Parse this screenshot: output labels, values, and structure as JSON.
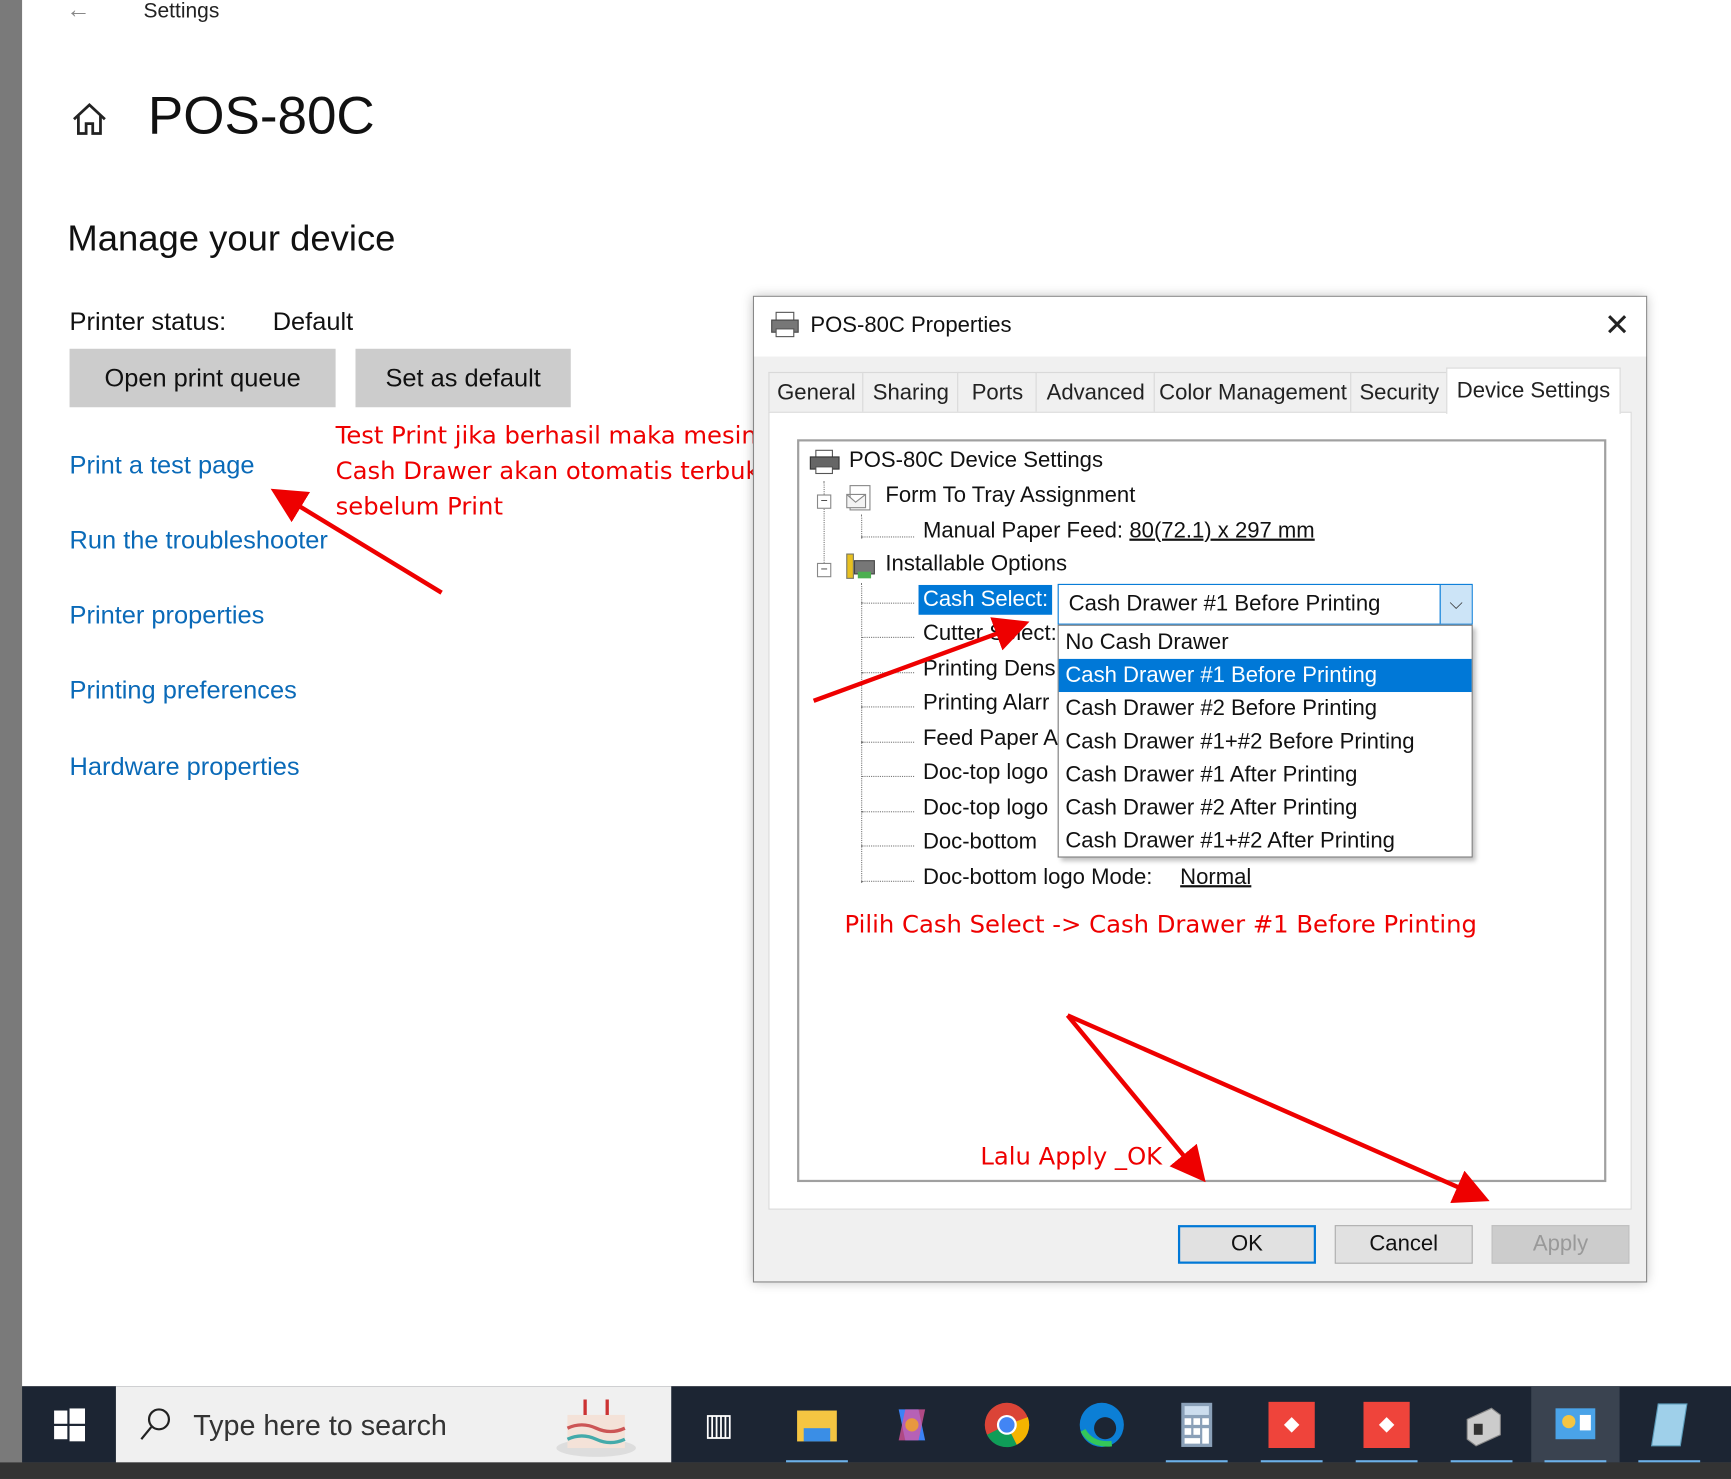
{
  "settings": {
    "window_title": "Settings",
    "page_title": "POS-80C",
    "section": "Manage your device",
    "status_label": "Printer status:",
    "status_value": "Default",
    "open_queue": "Open print queue",
    "set_default": "Set as default",
    "links": [
      "Print a test page",
      "Run the troubleshooter",
      "Printer properties",
      "Printing preferences",
      "Hardware properties"
    ]
  },
  "annotations": {
    "test_print": [
      "Test Print jika berhasil maka mesin",
      "Cash Drawer akan otomatis terbuka",
      "sebelum Print"
    ],
    "cash_select": "Pilih Cash Select -> Cash Drawer #1 Before Printing",
    "apply": "Lalu Apply _OK",
    "color": "#e00000"
  },
  "dialog": {
    "title": "POS-80C Properties",
    "tabs": [
      "General",
      "Sharing",
      "Ports",
      "Advanced",
      "Color Management",
      "Security",
      "Device Settings"
    ],
    "active_tab": "Device Settings",
    "tree": {
      "root": "POS-80C Device Settings",
      "form_tray": "Form To Tray Assignment",
      "manual_feed_label": "Manual Paper Feed:",
      "manual_feed_value": "80(72.1) x 297 mm",
      "installable": "Installable Options",
      "cash_select": "Cash Select:",
      "truncated_items": [
        "Cutter Select:",
        "Printing Dens",
        "Printing Alarr",
        "Feed Paper A",
        "Doc-top logo",
        "Doc-top logo",
        "Doc-bottom"
      ],
      "doc_bottom_label": "Doc-bottom logo Mode:",
      "doc_bottom_value": "Normal"
    },
    "combo_value": "Cash Drawer #1 Before Printing",
    "options": [
      "No Cash Drawer",
      "Cash Drawer #1 Before Printing",
      "Cash Drawer #2 Before Printing",
      "Cash Drawer #1+#2 Before Printing",
      "Cash Drawer #1 After Printing",
      "Cash Drawer #2 After Printing",
      "Cash Drawer #1+#2 After Printing"
    ],
    "selected_option": "Cash Drawer #1 Before Printing",
    "ok": "OK",
    "cancel": "Cancel",
    "apply": "Apply"
  },
  "taskbar": {
    "search_placeholder": "Type here to search",
    "apps": [
      "task-view",
      "file-explorer",
      "copilot",
      "chrome",
      "edge",
      "calculator",
      "anydesk",
      "anydesk",
      "printer-app",
      "control-panel",
      "notepad"
    ]
  }
}
